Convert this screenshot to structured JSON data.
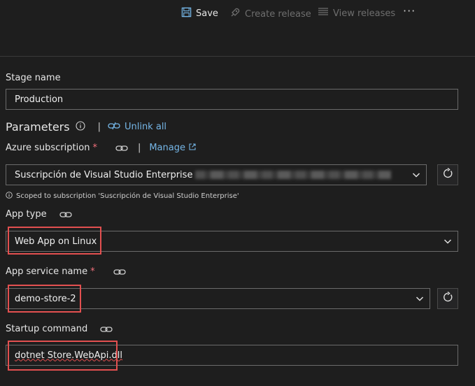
{
  "toolbar": {
    "save_label": "Save",
    "create_release_label": "Create release",
    "view_releases_label": "View releases",
    "more_label": "···"
  },
  "stage": {
    "label": "Stage name",
    "value": "Production"
  },
  "parameters": {
    "title": "Parameters",
    "unlink_all": "Unlink all"
  },
  "azure_subscription": {
    "label": "Azure subscription",
    "required": "*",
    "manage": "Manage",
    "value": "Suscripción de Visual Studio Enterprise",
    "scope_note": "Scoped to subscription 'Suscripción de Visual Studio Enterprise'"
  },
  "app_type": {
    "label": "App type",
    "value": "Web App on Linux"
  },
  "app_service_name": {
    "label": "App service name",
    "required": "*",
    "value": "demo-store-2"
  },
  "startup_command": {
    "label": "Startup command",
    "value": "dotnet Store.WebApi.dll"
  },
  "colors": {
    "background": "#1e1e1e",
    "link": "#75b6e7",
    "highlight": "#e35050",
    "required": "#f1707b"
  }
}
